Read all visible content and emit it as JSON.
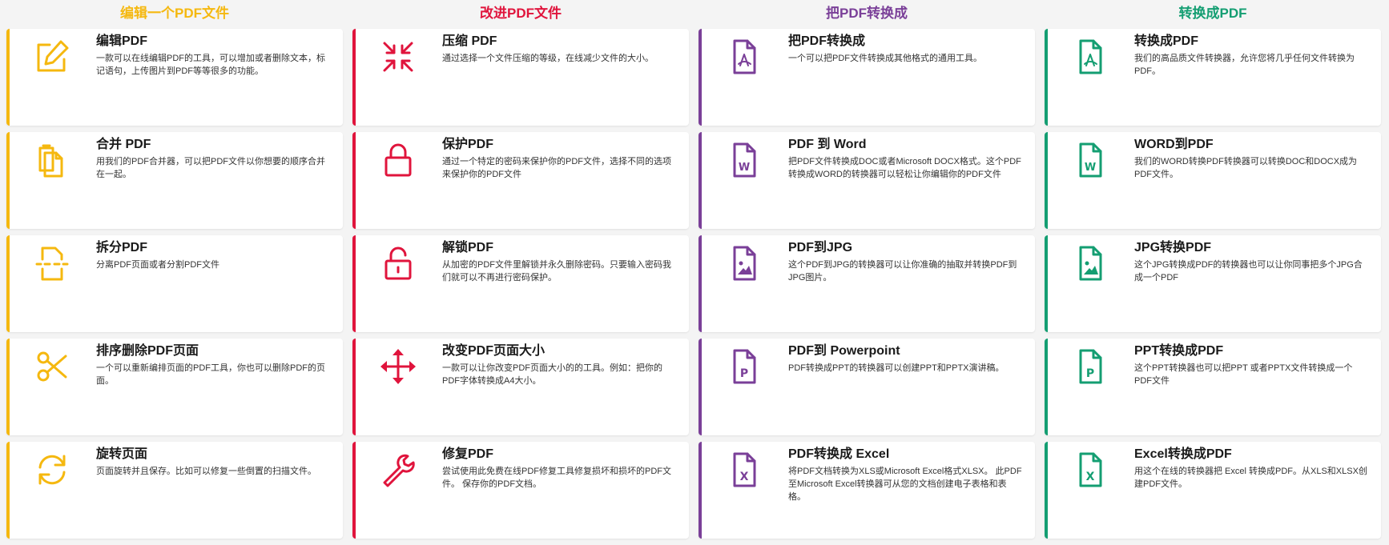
{
  "colors": {
    "yellow": "#f5b80f",
    "red": "#e0143c",
    "purple": "#7a3f98",
    "green": "#149e72"
  },
  "columns": [
    {
      "title": "编辑一个PDF文件",
      "cards": [
        {
          "title": "编辑PDF",
          "desc": "一款可以在线编辑PDF的工具，可以增加或者删除文本，标记语句，上传图片到PDF等等很多的功能。",
          "icon": "edit-icon"
        },
        {
          "title": "合并 PDF",
          "desc": "用我们的PDF合并器，可以把PDF文件以你想要的顺序合并在一起。",
          "icon": "merge-icon"
        },
        {
          "title": "拆分PDF",
          "desc": "分离PDF页面或者分割PDF文件",
          "icon": "split-icon"
        },
        {
          "title": "排序删除PDF页面",
          "desc": "一个可以重新编排页面的PDF工具，你也可以删除PDF的页面。",
          "icon": "scissors-icon"
        },
        {
          "title": "旋转页面",
          "desc": "页面旋转并且保存。比如可以修复一些倒置的扫描文件。",
          "icon": "rotate-icon"
        }
      ]
    },
    {
      "title": "改进PDF文件",
      "cards": [
        {
          "title": "压缩 PDF",
          "desc": "通过选择一个文件压缩的等级，在线减少文件的大小。",
          "icon": "compress-icon"
        },
        {
          "title": "保护PDF",
          "desc": "通过一个特定的密码来保护你的PDF文件，选择不同的选项来保护你的PDF文件",
          "icon": "lock-icon"
        },
        {
          "title": "解锁PDF",
          "desc": "从加密的PDF文件里解锁并永久删除密码。只要输入密码我们就可以不再进行密码保护。",
          "icon": "unlock-icon"
        },
        {
          "title": "改变PDF页面大小",
          "desc": "一款可以让你改变PDF页面大小的的工具。例如：把你的PDF字体转换成A4大小。",
          "icon": "move-icon"
        },
        {
          "title": "修复PDF",
          "desc": "尝试使用此免费在线PDF修复工具修复损坏和损坏的PDF文件。 保存你的PDF文档。",
          "icon": "wrench-icon"
        }
      ]
    },
    {
      "title": "把PDF转换成",
      "cards": [
        {
          "title": "把PDF转换成",
          "desc": "一个可以把PDF文件转换成其他格式的通用工具。",
          "icon": "pdf-file-icon"
        },
        {
          "title": "PDF 到 Word",
          "desc": "把PDF文件转换成DOC或者Microsoft DOCX格式。这个PDF转换成WORD的转换器可以轻松让你编辑你的PDF文件",
          "icon": "word-file-icon"
        },
        {
          "title": "PDF到JPG",
          "desc": "这个PDF到JPG的转换器可以让你准确的抽取并转换PDF到JPG图片。",
          "icon": "image-file-icon"
        },
        {
          "title": "PDF到 Powerpoint",
          "desc": "PDF转换成PPT的转换器可以创建PPT和PPTX演讲稿。",
          "icon": "ppt-file-icon"
        },
        {
          "title": "PDF转换成 Excel",
          "desc": "将PDF文档转换为XLS或Microsoft Excel格式XLSX。 此PDF至Microsoft Excel转换器可从您的文档创建电子表格和表格。",
          "icon": "excel-file-icon"
        }
      ]
    },
    {
      "title": "转换成PDF",
      "cards": [
        {
          "title": "转换成PDF",
          "desc": "我们的高品质文件转换器，允许您将几乎任何文件转换为PDF。",
          "icon": "pdf-file-icon"
        },
        {
          "title": "WORD到PDF",
          "desc": "我们的WORD转换PDF转换器可以转换DOC和DOCX成为PDF文件。",
          "icon": "word-file-icon"
        },
        {
          "title": "JPG转换PDF",
          "desc": "这个JPG转换成PDF的转换器也可以让你同事把多个JPG合成一个PDF",
          "icon": "image-file-icon"
        },
        {
          "title": "PPT转换成PDF",
          "desc": "这个PPT转换器也可以把PPT 或者PPTX文件转换成一个PDF文件",
          "icon": "ppt-file-icon"
        },
        {
          "title": "Excel转换成PDF",
          "desc": "用这个在线的转换器把 Excel 转换成PDF。从XLS和XLSX创建PDF文件。",
          "icon": "excel-file-icon"
        }
      ]
    }
  ],
  "icon_letters": {
    "word": "W",
    "ppt": "P",
    "excel": "X"
  }
}
